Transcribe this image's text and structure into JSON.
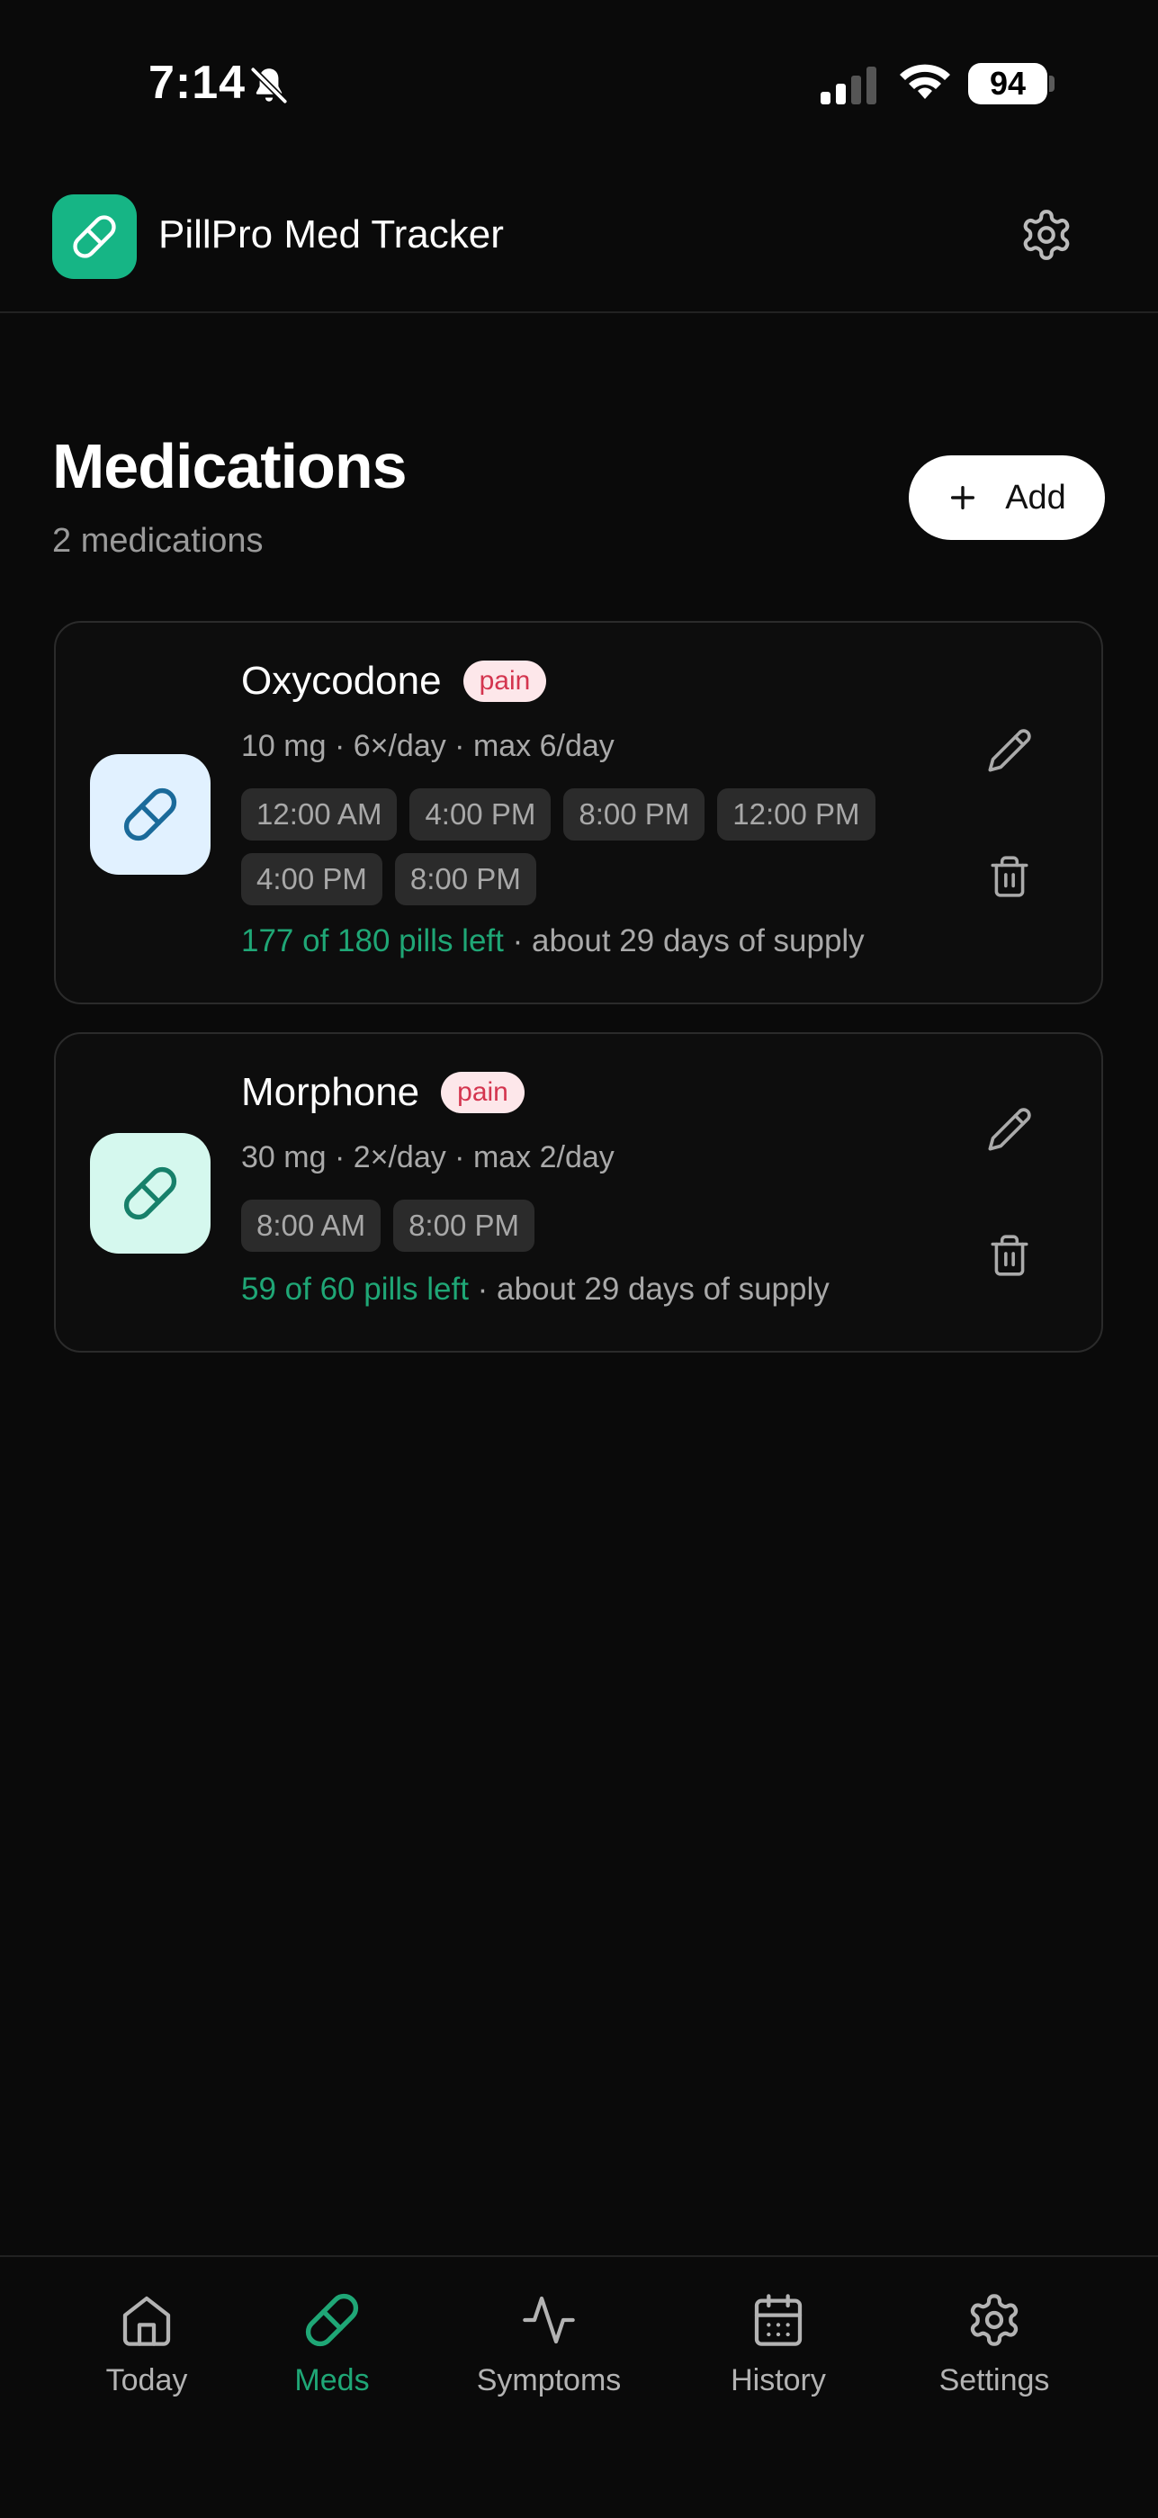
{
  "status_bar": {
    "time": "7:14",
    "battery": "94"
  },
  "header": {
    "app_title": "PillPro Med Tracker"
  },
  "page": {
    "title": "Medications",
    "subtitle": "2 medications",
    "add_label": "Add"
  },
  "medications": [
    {
      "name": "Oxycodone",
      "tag": "pain",
      "meta": "10 mg · 6×/day · max 6/day",
      "times": [
        "12:00 AM",
        "4:00 PM",
        "8:00 PM",
        "12:00 PM",
        "4:00 PM",
        "8:00 PM"
      ],
      "pills_left": "177 of 180 pills left",
      "supply_note": " · about 29 days of supply",
      "icon_bg": "#e1f1ff",
      "icon_color": "#1a6a9a"
    },
    {
      "name": "Morphone",
      "tag": "pain",
      "meta": "30 mg · 2×/day · max 2/day",
      "times": [
        "8:00 AM",
        "8:00 PM"
      ],
      "pills_left": "59 of 60 pills left",
      "supply_note": " · about 29 days of supply",
      "icon_bg": "#d5f8ee",
      "icon_color": "#17806a"
    }
  ],
  "nav": {
    "items": [
      {
        "label": "Today",
        "icon": "home-icon"
      },
      {
        "label": "Meds",
        "icon": "pill-icon",
        "active": true
      },
      {
        "label": "Symptoms",
        "icon": "activity-icon"
      },
      {
        "label": "History",
        "icon": "calendar-icon"
      },
      {
        "label": "Settings",
        "icon": "gear-icon"
      }
    ]
  },
  "colors": {
    "accent": "#16b585",
    "pills_text": "#1fa776",
    "tag_text": "#d4354f",
    "tag_bg": "#fde7ea"
  }
}
